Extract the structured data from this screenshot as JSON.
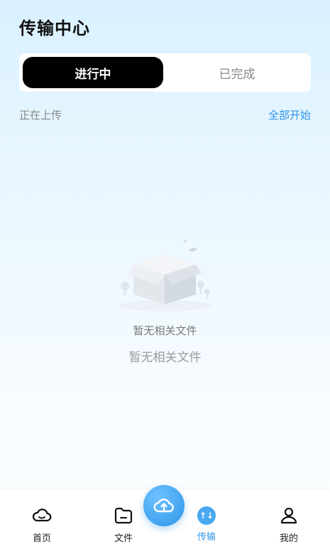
{
  "header": {
    "title": "传输中心"
  },
  "tabs": [
    {
      "label": "进行中",
      "active": true
    },
    {
      "label": "已完成",
      "active": false
    }
  ],
  "section": {
    "status_label": "正在上传",
    "action_label": "全部开始"
  },
  "empty": {
    "illustration_caption": "暂无相关文件",
    "message": "暂无相关文件"
  },
  "tabbar": {
    "items": [
      {
        "label": "首页",
        "icon": "cloud-icon"
      },
      {
        "label": "文件",
        "icon": "folder-icon"
      },
      {
        "label": "传输",
        "icon": "transfer-icon",
        "badge": "↑↓",
        "active": true
      },
      {
        "label": "我的",
        "icon": "person-icon"
      }
    ],
    "fab_icon": "cloud-upload-icon"
  },
  "colors": {
    "accent": "#2e95e8",
    "active_tab_bg": "#000000"
  }
}
